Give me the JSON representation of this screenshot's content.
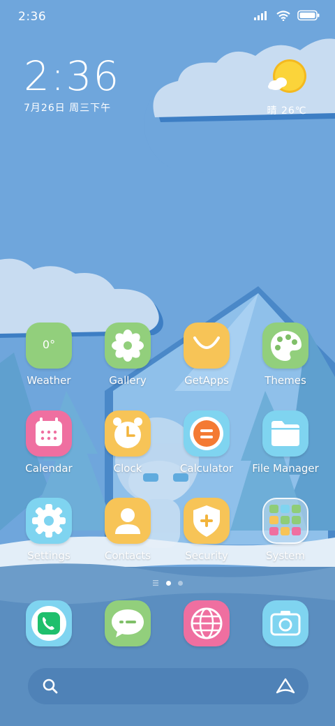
{
  "status_bar": {
    "time": "2:36"
  },
  "clock_widget": {
    "time": "2:36",
    "date": "7月26日 周三下午"
  },
  "weather_widget": {
    "condition": "晴",
    "temperature": "26℃",
    "text": "晴 26℃"
  },
  "apps": [
    {
      "label": "Weather",
      "badge_text": "0°"
    },
    {
      "label": "Gallery"
    },
    {
      "label": "GetApps"
    },
    {
      "label": "Themes"
    },
    {
      "label": "Calendar"
    },
    {
      "label": "Clock"
    },
    {
      "label": "Calculator"
    },
    {
      "label": "File Manager"
    },
    {
      "label": "Settings"
    },
    {
      "label": "Contacts"
    },
    {
      "label": "Security"
    },
    {
      "label": "System"
    }
  ],
  "dock": [
    "phone-icon",
    "messages-icon",
    "browser-icon",
    "camera-icon"
  ],
  "page_indicator": {
    "pages": 2,
    "current": 1
  },
  "colors": {
    "sky": "#6fa6dc",
    "green": "#8fcd78",
    "yellow": "#f6c455",
    "pink": "#ef6fa0",
    "cyan": "#7fd4f0",
    "white": "#ffffff"
  }
}
